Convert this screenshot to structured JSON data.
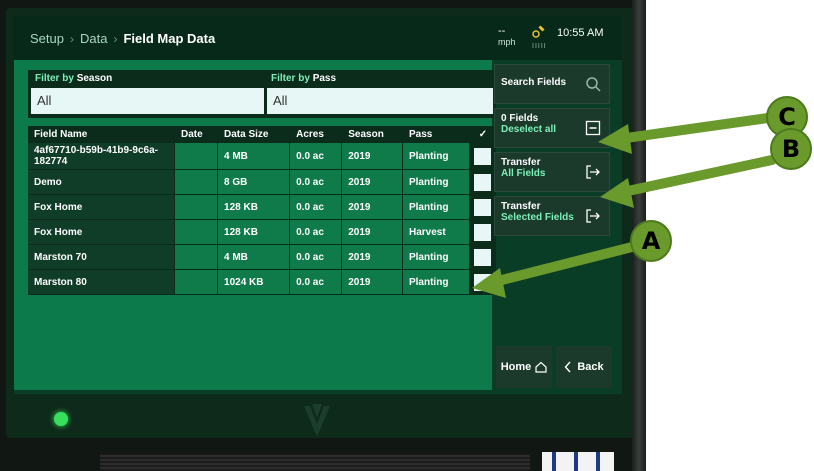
{
  "breadcrumb": {
    "items": [
      "Setup",
      "Data"
    ],
    "current": "Field Map Data",
    "separator": "›"
  },
  "status": {
    "speed": "--",
    "speed_unit": "mph",
    "signal": "IIIII",
    "time": "10:55 AM"
  },
  "filters": {
    "season": {
      "label_prefix": "Filter by",
      "label_field": "Season",
      "value": "All"
    },
    "pass": {
      "label_prefix": "Filter by",
      "label_field": "Pass",
      "value": "All"
    }
  },
  "table": {
    "headers": [
      "Field Name",
      "Date",
      "Data Size",
      "Acres",
      "Season",
      "Pass",
      "✓"
    ],
    "rows": [
      {
        "name": "4af67710-b59b-41b9-9c6a-182774",
        "date": "",
        "size": "4 MB",
        "acres": "0.0 ac",
        "season": "2019",
        "pass": "Planting"
      },
      {
        "name": "Demo",
        "date": "",
        "size": "8 GB",
        "acres": "0.0 ac",
        "season": "2019",
        "pass": "Planting"
      },
      {
        "name": "Fox Home",
        "date": "",
        "size": "128 KB",
        "acres": "0.0 ac",
        "season": "2019",
        "pass": "Planting"
      },
      {
        "name": "Fox Home",
        "date": "",
        "size": "128 KB",
        "acres": "0.0 ac",
        "season": "2019",
        "pass": "Harvest"
      },
      {
        "name": "Marston 70",
        "date": "",
        "size": "4 MB",
        "acres": "0.0 ac",
        "season": "2019",
        "pass": "Planting"
      },
      {
        "name": "Marston 80",
        "date": "",
        "size": "1024 KB",
        "acres": "0.0 ac",
        "season": "2019",
        "pass": "Planting"
      }
    ]
  },
  "actions": {
    "search": {
      "label": "Search Fields"
    },
    "deselect": {
      "line1": "0 Fields",
      "line2": "Deselect all"
    },
    "transfer_all": {
      "line1": "Transfer",
      "line2": "All Fields"
    },
    "transfer_selected": {
      "line1": "Transfer",
      "line2": "Selected Fields"
    },
    "home": "Home",
    "back": "Back"
  },
  "callouts": {
    "a": "A",
    "b": "B",
    "c": "C"
  },
  "colors": {
    "accent": "#7df0b8",
    "panel": "#0d7a4c",
    "callout": "#6a9a2b"
  }
}
